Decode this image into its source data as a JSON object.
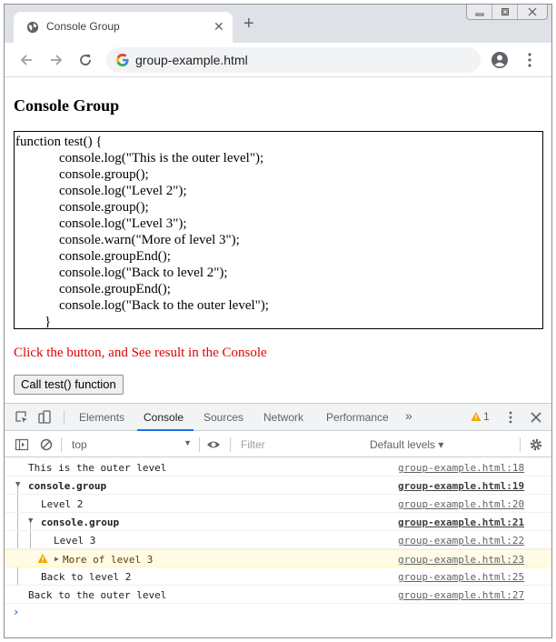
{
  "browser": {
    "tab_title": "Console Group",
    "url": "group-example.html"
  },
  "page": {
    "heading": "Console Group",
    "code_lines": [
      "function test() {",
      "console.log(\"This is the outer level\");",
      "console.group();",
      "console.log(\"Level 2\");",
      "console.group();",
      "console.log(\"Level 3\");",
      "console.warn(\"More of level 3\");",
      "console.groupEnd();",
      "console.log(\"Back to level 2\");",
      "console.groupEnd();",
      "console.log(\"Back to the outer level\");",
      "}"
    ],
    "message": "Click the button, and See result in the Console",
    "button_label": "Call test() function",
    "message_color": "#e00000"
  },
  "devtools": {
    "tabs": [
      "Elements",
      "Console",
      "Sources",
      "Network",
      "Performance"
    ],
    "more_tabs": "»",
    "active_tab": "Console",
    "warning_count": "1",
    "context": "top",
    "filter_placeholder": "Filter",
    "levels_label": "Default levels",
    "accent_color": "#1a73e8",
    "console_rows": [
      {
        "text": "This is the outer level",
        "source": "group-example.html:18",
        "type": "log"
      },
      {
        "text": "console.group",
        "source": "group-example.html:19",
        "type": "group"
      },
      {
        "text": "Level 2",
        "source": "group-example.html:20",
        "type": "log"
      },
      {
        "text": "console.group",
        "source": "group-example.html:21",
        "type": "group"
      },
      {
        "text": "Level 3",
        "source": "group-example.html:22",
        "type": "log"
      },
      {
        "text": "More of level 3",
        "source": "group-example.html:23",
        "type": "warn"
      },
      {
        "text": "Back to level 2",
        "source": "group-example.html:25",
        "type": "log"
      },
      {
        "text": "Back to the outer level",
        "source": "group-example.html:27",
        "type": "log"
      }
    ],
    "prompt_symbol": "›"
  },
  "icons": {
    "tab_favicon": "globe-icon",
    "back": "back-arrow-icon",
    "forward": "forward-arrow-icon",
    "reload": "reload-icon",
    "profile": "profile-icon",
    "menu": "kebab-menu-icon",
    "inspect": "inspect-icon",
    "device": "device-toolbar-icon",
    "warning": "warning-icon"
  }
}
